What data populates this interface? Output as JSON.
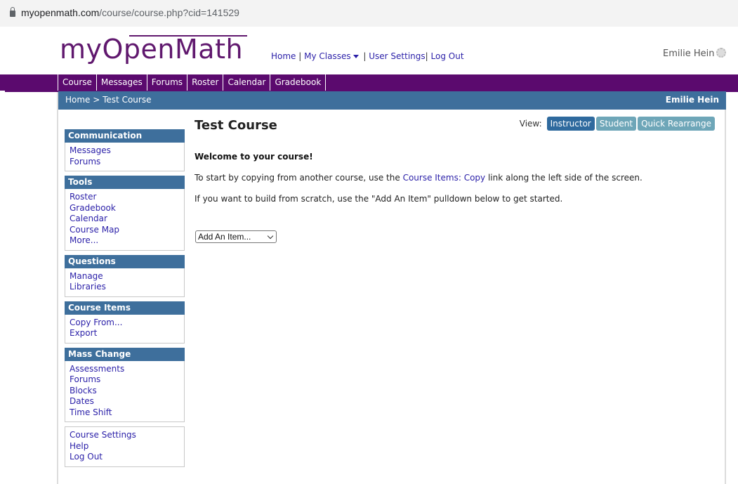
{
  "browser": {
    "url_host": "myopenmath.com",
    "url_path": "/course/course.php?cid=141529"
  },
  "header": {
    "logo": "myOpenMath",
    "nav": {
      "home": "Home",
      "sep1": " | ",
      "my_classes": "My Classes",
      "sep2": " | ",
      "user_settings": "User Settings",
      "sep3": "| ",
      "log_out": "Log Out"
    },
    "user_name": "Emilie Hein",
    "user_icon": "gear-icon"
  },
  "tabs": [
    "Course",
    "Messages",
    "Forums",
    "Roster",
    "Calendar",
    "Gradebook"
  ],
  "breadcrumb": {
    "text": "Home > Test Course",
    "user": "Emilie Hein"
  },
  "sidebar": {
    "blocks": [
      {
        "title": "Communication",
        "items": [
          "Messages",
          "Forums"
        ]
      },
      {
        "title": "Tools",
        "items": [
          "Roster",
          "Gradebook",
          "Calendar",
          "Course Map",
          "More..."
        ]
      },
      {
        "title": "Questions",
        "items": [
          "Manage",
          "Libraries"
        ]
      },
      {
        "title": "Course Items",
        "items": [
          "Copy From...",
          "Export"
        ]
      },
      {
        "title": "Mass Change",
        "items": [
          "Assessments",
          "Forums",
          "Blocks",
          "Dates",
          "Time Shift"
        ]
      }
    ],
    "footer_items": [
      "Course Settings",
      "Help",
      "Log Out"
    ]
  },
  "main": {
    "title": "Test Course",
    "view_label": "View:",
    "view_buttons": [
      "Instructor",
      "Student",
      "Quick Rearrange"
    ],
    "active_view": "Instructor",
    "welcome": "Welcome to your course!",
    "p1_before": "To start by copying from another course, use the ",
    "p1_link": "Course Items: Copy",
    "p1_after": " link along the left side of the screen.",
    "p2": "If you want to build from scratch, use the \"Add An Item\" pulldown below to get started.",
    "add_item_select": "Add An Item..."
  },
  "colors": {
    "purple": "#5b0a6e",
    "blue": "#3e6f9c",
    "link": "#2a1fa8",
    "view_inactive": "#6ea6b8"
  }
}
